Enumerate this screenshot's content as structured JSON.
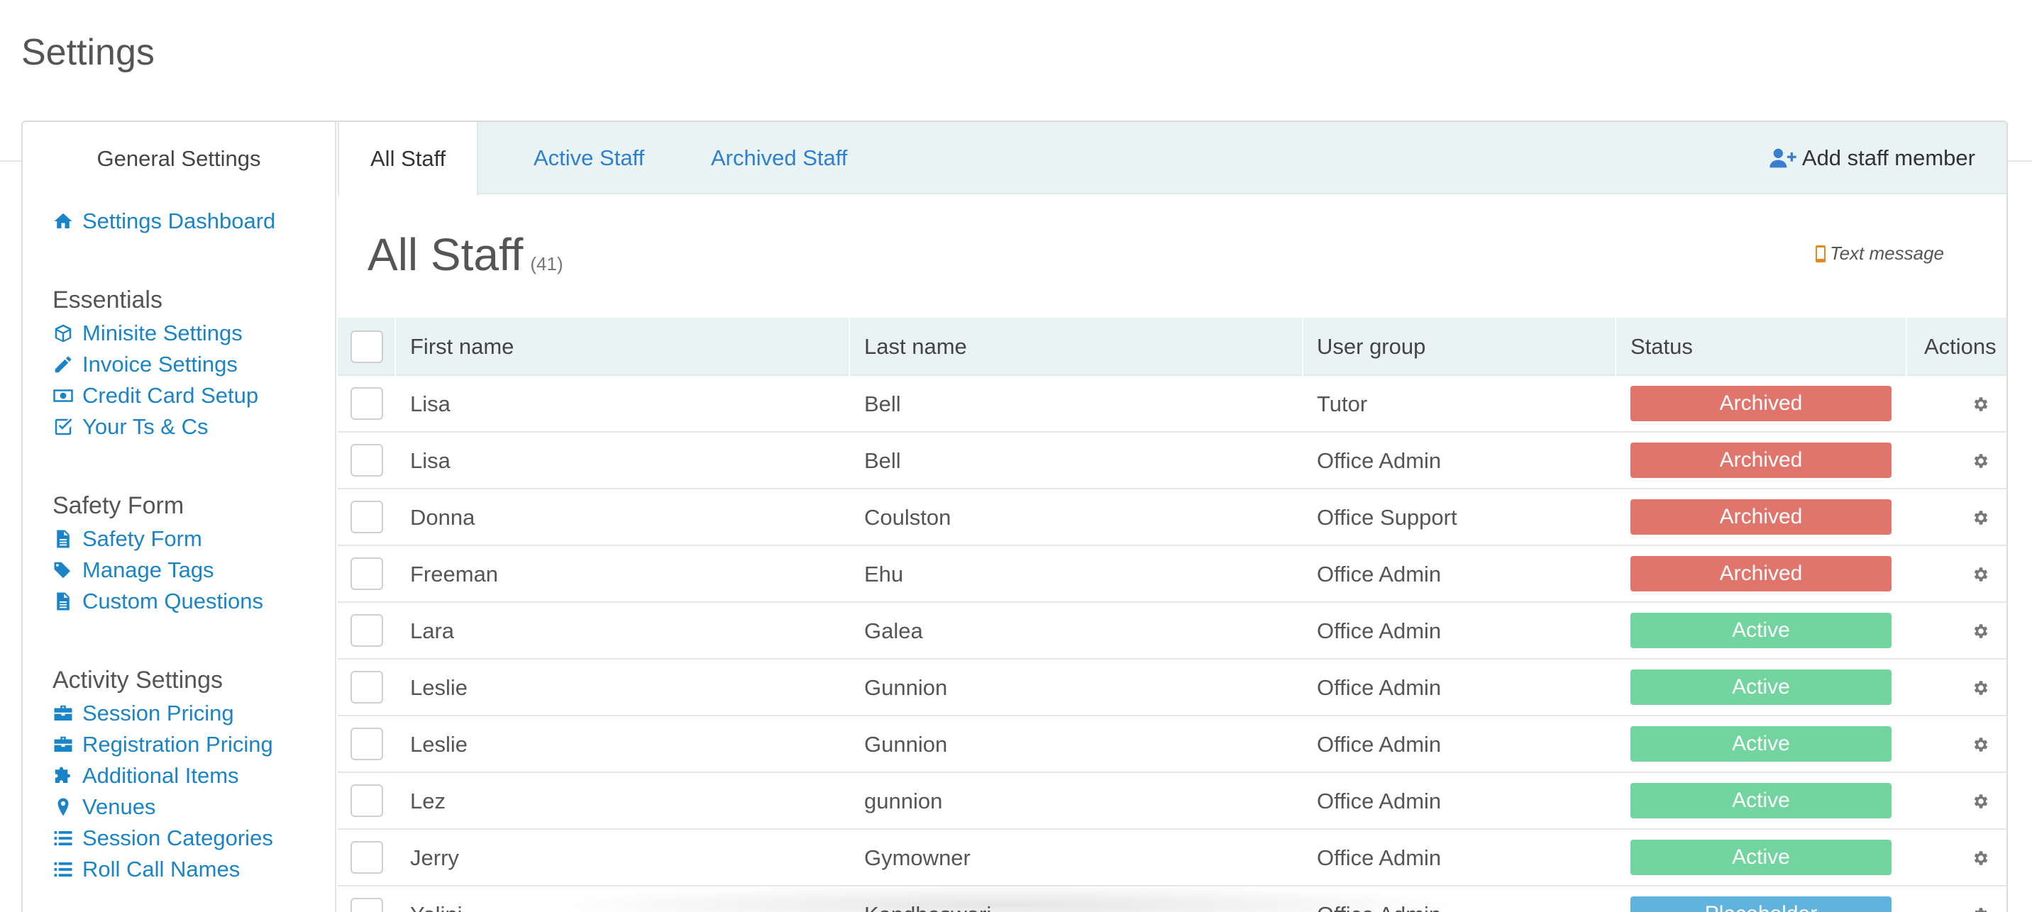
{
  "page": {
    "title": "Settings"
  },
  "sidebar": {
    "header": "General Settings",
    "dashboard": {
      "label": "Settings Dashboard",
      "icon": "home-icon"
    },
    "sections": [
      {
        "title": "Essentials",
        "items": [
          {
            "label": "Minisite Settings",
            "icon": "cube-icon"
          },
          {
            "label": "Invoice Settings",
            "icon": "pencil-icon"
          },
          {
            "label": "Credit Card Setup",
            "icon": "money-icon"
          },
          {
            "label": "Your Ts & Cs",
            "icon": "check-square-icon"
          }
        ]
      },
      {
        "title": "Safety Form",
        "items": [
          {
            "label": "Safety Form",
            "icon": "file-icon"
          },
          {
            "label": "Manage Tags",
            "icon": "tags-icon"
          },
          {
            "label": "Custom Questions",
            "icon": "file-icon"
          }
        ]
      },
      {
        "title": "Activity Settings",
        "items": [
          {
            "label": "Session Pricing",
            "icon": "briefcase-icon"
          },
          {
            "label": "Registration Pricing",
            "icon": "briefcase-icon"
          },
          {
            "label": "Additional Items",
            "icon": "puzzle-icon"
          },
          {
            "label": "Venues",
            "icon": "map-marker-icon"
          },
          {
            "label": "Session Categories",
            "icon": "list-icon"
          },
          {
            "label": "Roll Call Names",
            "icon": "list-icon"
          }
        ]
      }
    ]
  },
  "tabs": [
    {
      "label": "All Staff",
      "active": true
    },
    {
      "label": "Active Staff",
      "active": false
    },
    {
      "label": "Archived Staff",
      "active": false
    }
  ],
  "add_staff": {
    "label": "Add staff member",
    "icon": "user-plus-icon"
  },
  "content": {
    "heading": "All Staff",
    "count": "(41)",
    "text_message": {
      "label": "Text message",
      "icon": "mobile-icon"
    }
  },
  "table": {
    "columns": [
      "First name",
      "Last name",
      "User group",
      "Status",
      "Actions"
    ],
    "rows": [
      {
        "first": "Lisa",
        "last": "Bell",
        "group": "Tutor",
        "status": "Archived"
      },
      {
        "first": "Lisa",
        "last": "Bell",
        "group": "Office Admin",
        "status": "Archived"
      },
      {
        "first": "Donna",
        "last": "Coulston",
        "group": "Office Support",
        "status": "Archived"
      },
      {
        "first": "Freeman",
        "last": "Ehu",
        "group": "Office Admin",
        "status": "Archived"
      },
      {
        "first": "Lara",
        "last": "Galea",
        "group": "Office Admin",
        "status": "Active"
      },
      {
        "first": "Leslie",
        "last": "Gunnion",
        "group": "Office Admin",
        "status": "Active"
      },
      {
        "first": "Leslie",
        "last": "Gunnion",
        "group": "Office Admin",
        "status": "Active"
      },
      {
        "first": "Lez",
        "last": "gunnion",
        "group": "Office Admin",
        "status": "Active"
      },
      {
        "first": "Jerry",
        "last": "Gymowner",
        "group": "Office Admin",
        "status": "Active"
      },
      {
        "first": "Yalini",
        "last": "Kandheswari",
        "group": "Office Admin",
        "status": "Placeholder"
      }
    ]
  },
  "colors": {
    "link": "#1a84c7",
    "tab_link": "#2f7fd0",
    "status_archived": "#e0766b",
    "status_active": "#72d59f",
    "status_placeholder": "#5fb3dd",
    "header_bg": "#e9f3f4"
  }
}
